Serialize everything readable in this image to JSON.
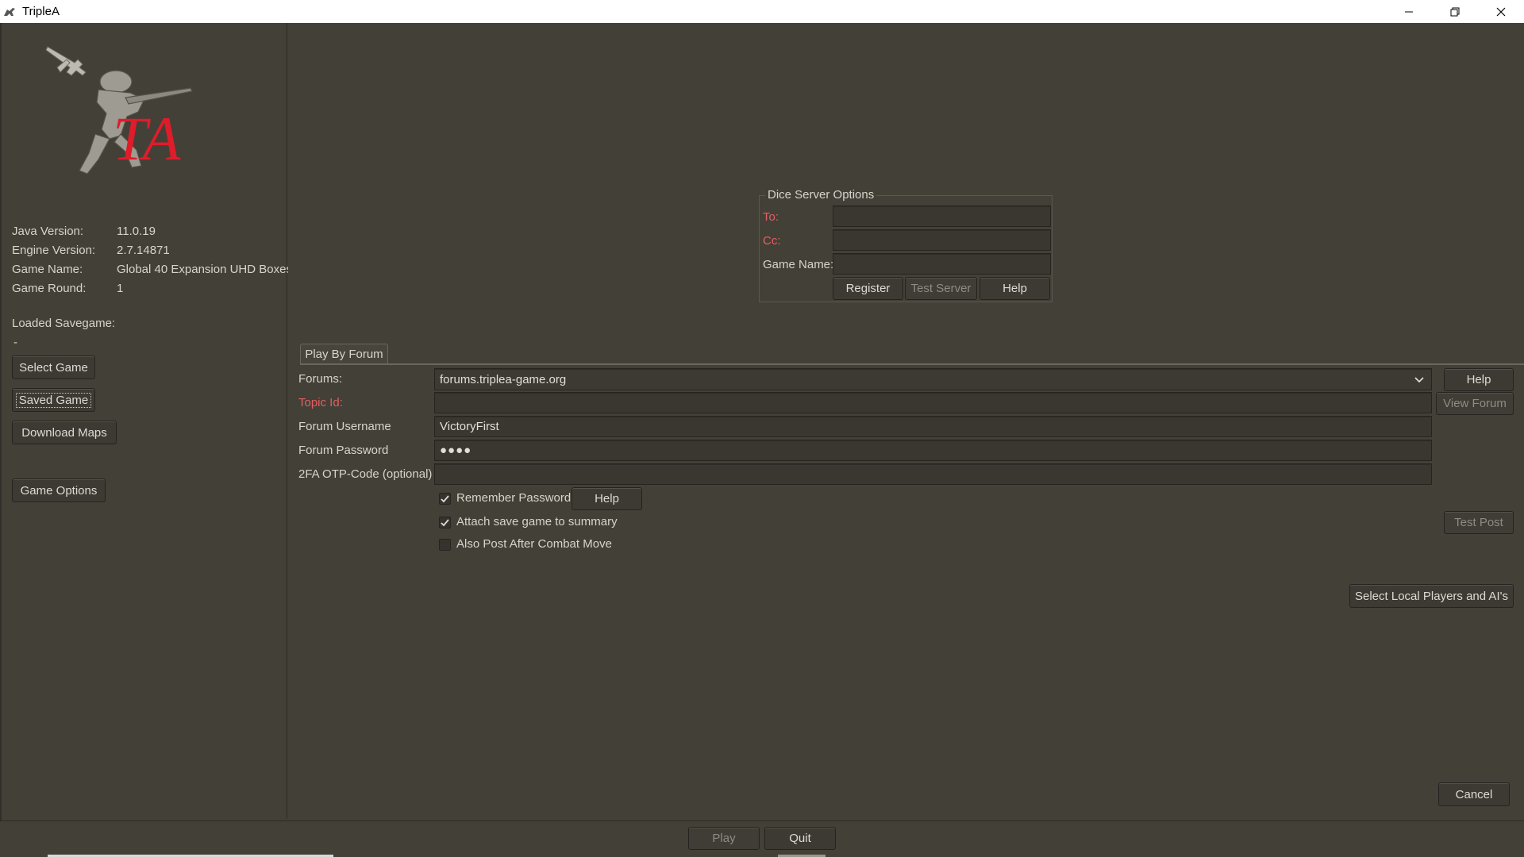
{
  "window": {
    "title": "TripleA",
    "minimize_icon": "minimize-icon",
    "maximize_icon": "restore-icon",
    "close_icon": "close-icon"
  },
  "sidebar": {
    "logo_text": "TA",
    "info": [
      {
        "label": "Java Version:",
        "value": "11.0.19"
      },
      {
        "label": "Engine Version:",
        "value": "2.7.14871"
      },
      {
        "label": "Game Name:",
        "value": "Global 40 Expansion UHD Boxes"
      },
      {
        "label": "Game Round:",
        "value": "1"
      }
    ],
    "loaded_savegame_label": "Loaded Savegame:",
    "loaded_savegame_value": "-",
    "buttons": {
      "select_game": "Select Game",
      "saved_game": "Saved Game",
      "download_maps": "Download Maps",
      "game_options": "Game Options"
    }
  },
  "dice_server": {
    "title": "Dice Server Options",
    "to_label": "To:",
    "cc_label": "Cc:",
    "game_name_label": "Game Name:",
    "to_value": "",
    "cc_value": "",
    "game_name_value": "",
    "register": "Register",
    "test_server": "Test Server",
    "help": "Help"
  },
  "forum": {
    "tab_label": "Play By Forum",
    "forums_label": "Forums:",
    "forums_value": "forums.triplea-game.org",
    "help": "Help",
    "topic_id_label": "Topic Id:",
    "topic_id_value": "",
    "view_forum": "View Forum",
    "username_label": "Forum Username",
    "username_value": "VictoryFirst",
    "password_label": "Forum Password",
    "password_value": "●●●●",
    "otp_label": "2FA OTP-Code (optional)",
    "otp_value": "",
    "remember_password": "Remember Password",
    "remember_password_checked": true,
    "remember_help": "Help",
    "attach_save": "Attach save game to summary",
    "attach_save_checked": true,
    "also_post": "Also Post After Combat Move",
    "also_post_checked": false,
    "test_post": "Test Post",
    "select_local_players": "Select Local Players and AI's",
    "cancel": "Cancel"
  },
  "bottom": {
    "play": "Play",
    "quit": "Quit"
  }
}
